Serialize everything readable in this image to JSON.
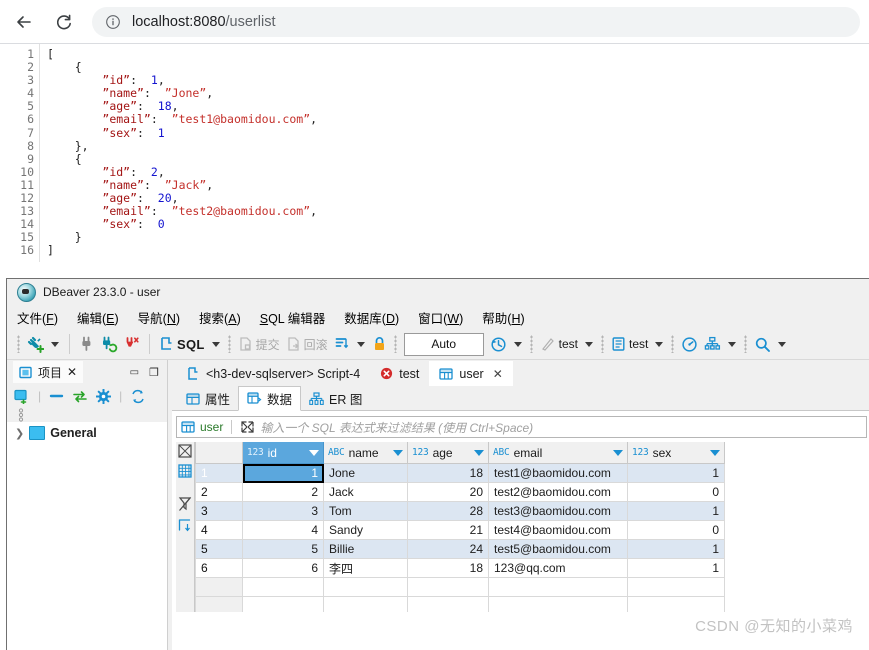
{
  "browser": {
    "back_label": "Back",
    "reload_label": "Reload",
    "info_label": "Site information",
    "url_host": "localhost:8080",
    "url_path": "/userlist"
  },
  "json_view": {
    "line_numbers": [
      "1",
      "2",
      "3",
      "4",
      "5",
      "6",
      "7",
      "8",
      "9",
      "10",
      "11",
      "12",
      "13",
      "14",
      "15",
      "16"
    ],
    "lines": [
      "[",
      "    {",
      "        \"id\":  1,",
      "        \"name\":  \"Jone\",",
      "        \"age\":  18,",
      "        \"email\":  \"test1@baomidou.com\",",
      "        \"sex\":  1",
      "    },",
      "    {",
      "        \"id\":  2,",
      "        \"name\":  \"Jack\",",
      "        \"age\":  20,",
      "        \"email\":  \"test2@baomidou.com\",",
      "        \"sex\":  0",
      "    }",
      "]"
    ],
    "records": [
      {
        "id": "1",
        "name": "Jone",
        "age": "18",
        "email": "test1@baomidou.com",
        "sex": "1"
      },
      {
        "id": "2",
        "name": "Jack",
        "age": "20",
        "email": "test2@baomidou.com",
        "sex": "0"
      }
    ]
  },
  "dbeaver": {
    "title": "DBeaver 23.3.0 - user",
    "menu": [
      {
        "pre": "文件(",
        "key": "F",
        "post": ")"
      },
      {
        "pre": "编辑(",
        "key": "E",
        "post": ")"
      },
      {
        "pre": "导航(",
        "key": "N",
        "post": ")"
      },
      {
        "pre": "搜索(",
        "key": "A",
        "post": ")"
      },
      {
        "pre": "",
        "key": "S",
        "post": "QL 编辑器"
      },
      {
        "pre": "数据库(",
        "key": "D",
        "post": ")"
      },
      {
        "pre": "窗口(",
        "key": "W",
        "post": ")"
      },
      {
        "pre": "帮助(",
        "key": "H",
        "post": ")"
      }
    ],
    "toolbar": {
      "sql_label": "SQL",
      "commit_label": "提交",
      "rollback_label": "回滚",
      "auto_value": "Auto",
      "connection_name": "test",
      "database_name": "test"
    },
    "left_panel": {
      "tab_label": "项目",
      "tree_root": "General"
    },
    "editor_tabs": [
      {
        "label": "<h3-dev-sqlserver> Script-4",
        "icon": "sql-editor-icon",
        "active": false,
        "closable": false
      },
      {
        "label": "test",
        "icon": "error-icon",
        "active": false,
        "closable": false
      },
      {
        "label": "user",
        "icon": "table-icon",
        "active": true,
        "closable": true
      }
    ],
    "sub_tabs": [
      {
        "label": "属性",
        "icon": "properties-icon",
        "active": false
      },
      {
        "label": "数据",
        "icon": "data-icon",
        "active": true
      },
      {
        "label": "ER 图",
        "icon": "er-diagram-icon",
        "active": false
      }
    ],
    "filter": {
      "object_name": "user",
      "placeholder": "输入一个 SQL 表达式来过滤结果 (使用 Ctrl+Space)"
    },
    "grid": {
      "columns": [
        {
          "name": "id",
          "type_badge": "123",
          "selected": true
        },
        {
          "name": "name",
          "type_badge": "ABC",
          "selected": false
        },
        {
          "name": "age",
          "type_badge": "123",
          "selected": false
        },
        {
          "name": "email",
          "type_badge": "ABC",
          "selected": false
        },
        {
          "name": "sex",
          "type_badge": "123",
          "selected": false
        }
      ],
      "rows": [
        {
          "n": "1",
          "id": "1",
          "name": "Jone",
          "age": "18",
          "email": "test1@baomidou.com",
          "sex": "1"
        },
        {
          "n": "2",
          "id": "2",
          "name": "Jack",
          "age": "20",
          "email": "test2@baomidou.com",
          "sex": "0"
        },
        {
          "n": "3",
          "id": "3",
          "name": "Tom",
          "age": "28",
          "email": "test3@baomidou.com",
          "sex": "1"
        },
        {
          "n": "4",
          "id": "4",
          "name": "Sandy",
          "age": "21",
          "email": "test4@baomidou.com",
          "sex": "0"
        },
        {
          "n": "5",
          "id": "5",
          "name": "Billie",
          "age": "24",
          "email": "test5@baomidou.com",
          "sex": "1"
        },
        {
          "n": "6",
          "id": "6",
          "name": "李四",
          "age": "18",
          "email": "123@qq.com",
          "sex": "1"
        }
      ],
      "selected_row_index": 0,
      "focused_cell": "id"
    }
  },
  "watermark": "CSDN @无知的小菜鸡",
  "colors": {
    "accent_blue": "#5ba7dd",
    "icon_blue": "#1a8fd1",
    "alt_row": "#dce6f2",
    "json_key": "#a31515",
    "json_string": "#c4302b",
    "json_number": "#1414cf"
  }
}
